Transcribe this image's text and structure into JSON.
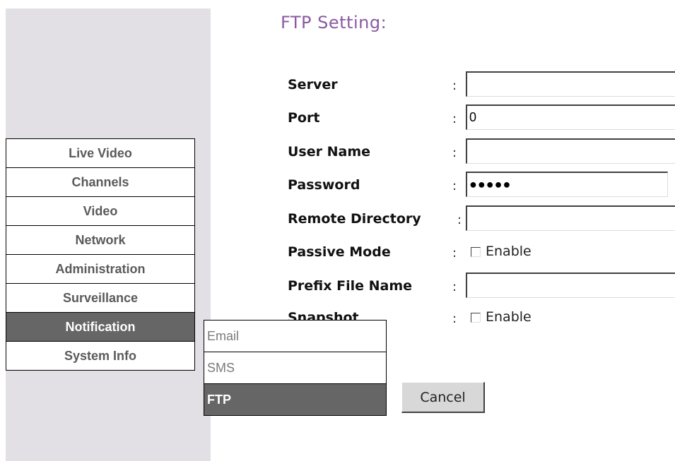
{
  "page": {
    "title": "FTP Setting:"
  },
  "menu": {
    "items": [
      {
        "label": "Live Video",
        "active": false
      },
      {
        "label": "Channels",
        "active": false
      },
      {
        "label": "Video",
        "active": false
      },
      {
        "label": "Network",
        "active": false
      },
      {
        "label": "Administration",
        "active": false
      },
      {
        "label": "Surveillance",
        "active": false
      },
      {
        "label": "Notification",
        "active": true
      },
      {
        "label": "System Info",
        "active": false
      }
    ]
  },
  "submenu": {
    "items": [
      {
        "label": "Email",
        "active": false
      },
      {
        "label": "SMS",
        "active": false
      },
      {
        "label": "FTP",
        "active": true
      }
    ]
  },
  "form": {
    "server": {
      "label": "Server",
      "value": ""
    },
    "port": {
      "label": "Port",
      "value": "0"
    },
    "username": {
      "label": "User Name",
      "value": ""
    },
    "password": {
      "label": "Password",
      "value": "●●●●●"
    },
    "remote_directory": {
      "label": "Remote Directory",
      "value": ""
    },
    "passive_mode": {
      "label": "Passive Mode",
      "checkbox_label": "Enable",
      "checked": false
    },
    "prefix_file_name": {
      "label": "Prefix File Name",
      "value": ""
    },
    "snapshot": {
      "label": "Snapshot",
      "checkbox_label": "Enable",
      "checked": false
    }
  },
  "buttons": {
    "cancel_label": "Cancel"
  },
  "colors": {
    "accent": "#8a5aa3",
    "active_bg": "#666666",
    "sidebar_bg": "#e2e0e4"
  }
}
